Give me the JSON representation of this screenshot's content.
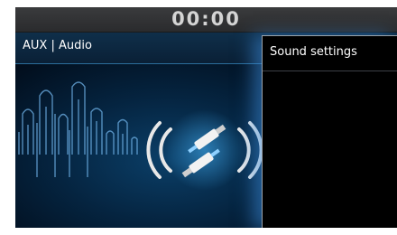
{
  "status_bar": {
    "clock": "00:00"
  },
  "header": {
    "title": "AUX | Audio"
  },
  "panel": {
    "title": "Sound settings"
  },
  "icons": {
    "center": "aux-cable-icon",
    "waves": "sound-wave-icon"
  },
  "colors": {
    "accent": "#2fa8ff",
    "panel_border": "#9aa1a8",
    "background": "#03152a"
  }
}
